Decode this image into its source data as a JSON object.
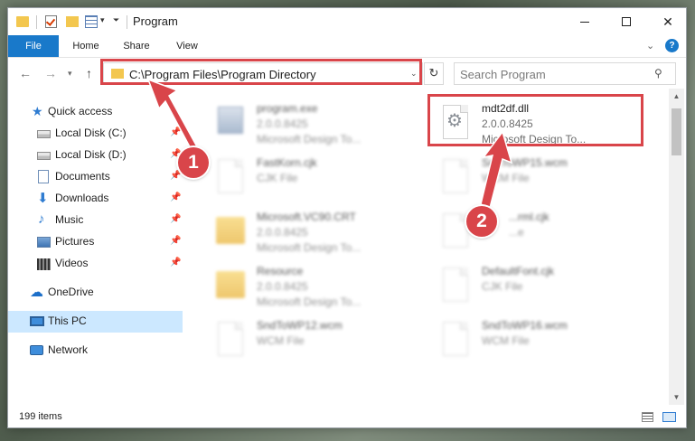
{
  "window": {
    "title": "Program",
    "ribbon_tabs": [
      "File",
      "Home",
      "Share",
      "View"
    ],
    "help_glyph": "?"
  },
  "navigation": {
    "address": "C:\\Program Files\\Program Directory",
    "search_placeholder": "Search Program"
  },
  "sidebar": {
    "items": [
      {
        "label": "Quick access",
        "icon": "star-icon"
      },
      {
        "label": "Local Disk (C:)",
        "icon": "drive-icon",
        "pinned": true
      },
      {
        "label": "Local Disk (D:)",
        "icon": "drive-icon",
        "pinned": true
      },
      {
        "label": "Documents",
        "icon": "documents-icon",
        "pinned": true
      },
      {
        "label": "Downloads",
        "icon": "download-icon",
        "pinned": true
      },
      {
        "label": "Music",
        "icon": "music-icon",
        "pinned": true
      },
      {
        "label": "Pictures",
        "icon": "pictures-icon",
        "pinned": true
      },
      {
        "label": "Videos",
        "icon": "videos-icon",
        "pinned": true
      },
      {
        "label": "OneDrive",
        "icon": "cloud-icon"
      },
      {
        "label": "This PC",
        "icon": "pc-icon",
        "selected": true
      },
      {
        "label": "Network",
        "icon": "network-icon"
      }
    ]
  },
  "files": [
    {
      "name": "program.exe",
      "line2": "2.0.0.8425",
      "line3": "Microsoft Design To...",
      "icon": "exe-icon"
    },
    {
      "name": "mdt2df.dll",
      "line2": "2.0.0.8425",
      "line3": "Microsoft Design To...",
      "icon": "dll-gear-icon",
      "highlighted": true
    },
    {
      "name": "FastKorn.cjk",
      "line2": "CJK File",
      "icon": "file-icon"
    },
    {
      "name": "SndToWP15.wcm",
      "line2": "WCM File",
      "icon": "file-icon"
    },
    {
      "name": "Microsoft.VC90.CRT",
      "line2": "2.0.0.8425",
      "line3": "Microsoft Design To...",
      "icon": "folder-icon"
    },
    {
      "name": "...rml.cjk",
      "line2": "...e",
      "icon": "file-icon"
    },
    {
      "name": "Resource",
      "line2": "2.0.0.8425",
      "line3": "Microsoft Design To...",
      "icon": "folder-icon"
    },
    {
      "name": "DefaultFont.cjk",
      "line2": "CJK File",
      "icon": "file-icon"
    },
    {
      "name": "SndToWP12.wcm",
      "line2": "WCM File",
      "icon": "file-icon"
    },
    {
      "name": "SndToWP16.wcm",
      "line2": "WCM File",
      "icon": "file-icon"
    }
  ],
  "status": {
    "item_count": "199 items"
  },
  "annotations": {
    "badge1": "1",
    "badge2": "2",
    "accent_color": "#d9454a"
  }
}
